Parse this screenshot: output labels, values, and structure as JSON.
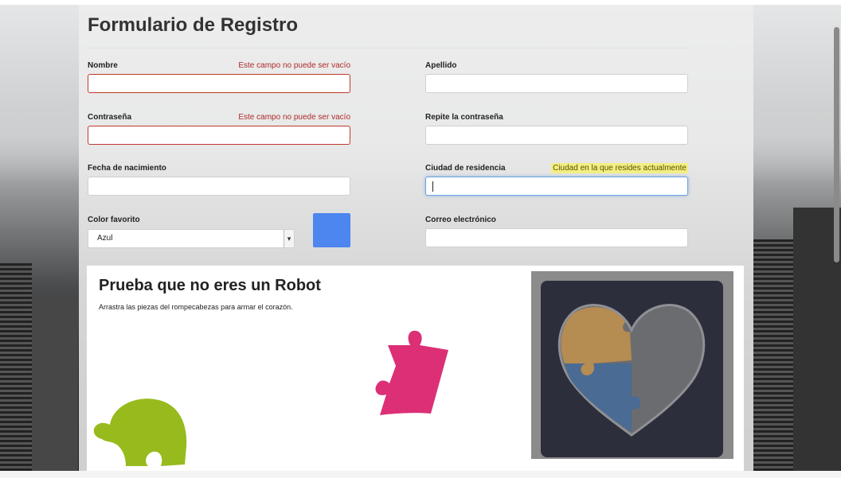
{
  "form": {
    "title": "Formulario de Registro",
    "fields": {
      "nombre": {
        "label": "Nombre",
        "error": "Este campo no puede ser vacío",
        "value": ""
      },
      "apellido": {
        "label": "Apellido",
        "value": ""
      },
      "contrasena": {
        "label": "Contraseña",
        "error": "Este campo no puede ser vacío",
        "value": ""
      },
      "repite": {
        "label": "Repite la contraseña",
        "value": ""
      },
      "fecha": {
        "label": "Fecha de nacimiento",
        "value": ""
      },
      "ciudad": {
        "label": "Ciudad de residencia",
        "hint": "Ciudad en la que resides actualmente",
        "value": ""
      },
      "color": {
        "label": "Color favorito",
        "selected": "Azul",
        "swatch": "#4c86ee"
      },
      "correo": {
        "label": "Correo electrónico",
        "value": ""
      }
    }
  },
  "captcha": {
    "title": "Prueba que no eres un Robot",
    "instructions": "Arrastra las piezas del rompecabezas para armar el corazón.",
    "pieces": [
      {
        "name": "green-piece",
        "color": "#97bb1c"
      },
      {
        "name": "pink-piece",
        "color": "#dc2f76"
      }
    ],
    "placed_pieces": [
      {
        "name": "tan-piece",
        "color": "#b58c52"
      },
      {
        "name": "blue-piece",
        "color": "#4a6b93"
      }
    ],
    "heart_color": "#6b6c70"
  }
}
